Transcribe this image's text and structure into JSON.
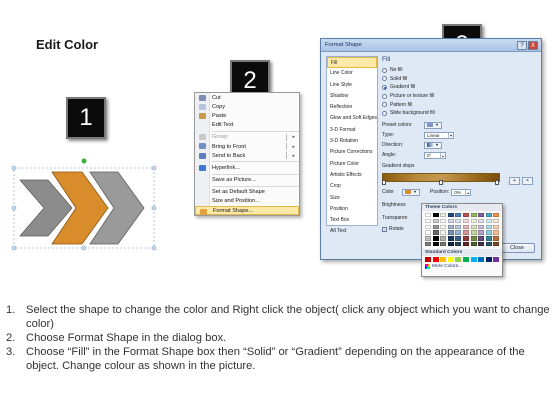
{
  "title": "Edit Color",
  "steps": {
    "one": "1",
    "two": "2",
    "three": "3"
  },
  "colors": {
    "orange": "#d98c2b",
    "gray": "#8c8c8c",
    "badge": "#0b0b0b",
    "dialog_bg": "#dfe8f5"
  },
  "context_menu": {
    "items": [
      {
        "label": "Cut",
        "icon": "scissors-icon"
      },
      {
        "label": "Copy",
        "icon": "copy-icon"
      },
      {
        "label": "Paste",
        "icon": "paste-icon"
      },
      {
        "label": "Edit Text"
      },
      {
        "label": "Group",
        "icon": "group-icon",
        "disabled": true
      },
      {
        "label": "Bring to Front",
        "icon": "bring-front-icon"
      },
      {
        "label": "Send to Back",
        "icon": "send-back-icon"
      },
      {
        "label": "Hyperlink...",
        "icon": "hyperlink-icon"
      },
      {
        "label": "Save as Picture..."
      },
      {
        "label": "Set as Default Shape"
      },
      {
        "label": "Size and Position..."
      },
      {
        "label": "Format Shape...",
        "icon": "format-shape-icon",
        "highlighted": true
      }
    ]
  },
  "dialog": {
    "title": "Format Shape",
    "help_button": "?",
    "close_x": "X",
    "categories": [
      "Fill",
      "Line Color",
      "Line Style",
      "Shadow",
      "Reflection",
      "Glow and Soft Edges",
      "3-D Format",
      "3-D Rotation",
      "Picture Corrections",
      "Picture Color",
      "Artistic Effects",
      "Crop",
      "Size",
      "Position",
      "Text Box",
      "Alt Text"
    ],
    "section_title": "Fill",
    "fill_options": [
      "No fill",
      "Solid fill",
      "Gradient fill",
      "Picture or texture fill",
      "Pattern fill",
      "Slide background fill"
    ],
    "selected_fill": 2,
    "preset_colors_label": "Preset colors:",
    "type_label": "Type:",
    "type_value": "Linear",
    "direction_label": "Direction:",
    "angle_label": "Angle:",
    "angle_value": "0°",
    "gradient_stops_label": "Gradient stops",
    "color_label": "Color",
    "position_label": "Position:",
    "position_value": "0%",
    "brightness_label": "Brightness",
    "transparency_label": "Transparen",
    "rotate_label": "Rotate",
    "close_button": "Close"
  },
  "picker": {
    "theme_colors_label": "Theme Colors",
    "standard_colors_label": "Standard Colors",
    "more_colors_label": "More Colors...",
    "theme_top": [
      "#ffffff",
      "#000000",
      "#eeece1",
      "#1f497d",
      "#4f81bd",
      "#c0504d",
      "#9bbb59",
      "#8064a2",
      "#4bacc6",
      "#f79646"
    ],
    "standard": [
      "#c00000",
      "#ff0000",
      "#ffc000",
      "#ffff00",
      "#92d050",
      "#00b050",
      "#00b0f0",
      "#0070c0",
      "#002060",
      "#7030a0"
    ]
  },
  "instructions": [
    {
      "num": "1.",
      "text": "Select the shape to change the color and Right click the object( click any object which you want to change color)"
    },
    {
      "num": "2.",
      "text": "Choose Format Shape in the dialog box."
    },
    {
      "num": "3.",
      "text": "Choose “Fill” in the Format Shape box then “Solid” or “Gradient” depending on the appearance of the object. Change colour as shown in the picture."
    }
  ]
}
